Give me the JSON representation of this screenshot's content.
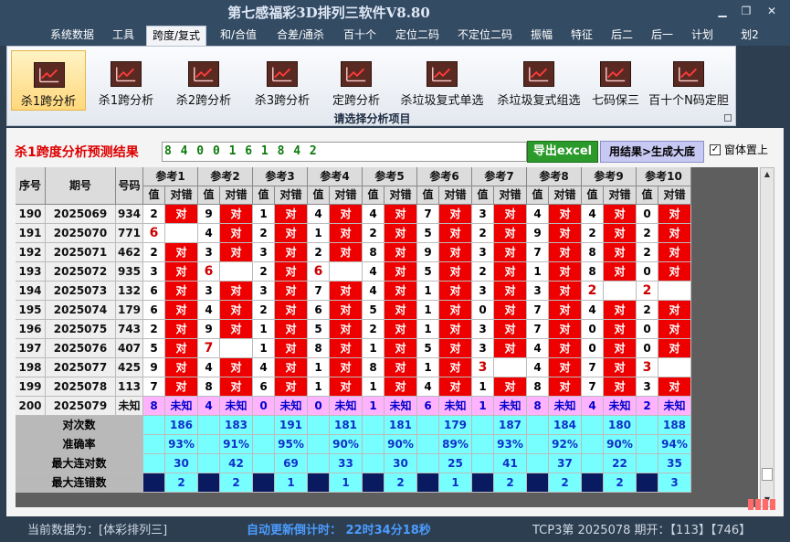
{
  "window": {
    "title": "第七感福彩3D排列三软件V8.80",
    "controls": [
      "minimize-icon",
      "restore-icon",
      "close-icon"
    ]
  },
  "menu": {
    "tabs": [
      "系统数据",
      "工具",
      "跨度/复式",
      "和/合值",
      "合差/通杀",
      "百十个",
      "定位二码",
      "不定位二码",
      "振幅",
      "特征",
      "后二",
      "后一",
      "计划",
      "划2"
    ],
    "active": "跨度/复式"
  },
  "ribbon": {
    "buttons": [
      "杀1跨分析",
      "杀1跨分析",
      "杀2跨分析",
      "杀3跨分析",
      "定跨分析",
      "杀垃圾复式单选",
      "杀垃圾复式组选",
      "七码保三",
      "百十个N码定胆"
    ],
    "active_index": 0,
    "caption": "请选择分析项目",
    "accent": "#ffd87b"
  },
  "result": {
    "title": "杀1跨度分析预测结果",
    "value": "8 4 0 0 1 6 1 8 4 2",
    "export_button": "导出excel",
    "generate_button": "用结果>生成大底",
    "keep_on_top_label": "窗体置上",
    "keep_on_top_checked": true,
    "check_mark": "✓"
  },
  "table": {
    "headers": {
      "index": "序号",
      "issue": "期号",
      "number": "号码",
      "refs": [
        "参考1",
        "参考2",
        "参考3",
        "参考4",
        "参考5",
        "参考6",
        "参考7",
        "参考8",
        "参考9",
        "参考10"
      ],
      "value": "值",
      "check": "对错"
    },
    "correct_label": "对",
    "rows": [
      {
        "idx": "190",
        "issue": "2025069",
        "num": "934",
        "v": [
          "2",
          "9",
          "1",
          "4",
          "4",
          "7",
          "3",
          "4",
          "4",
          "0"
        ],
        "ok": [
          1,
          1,
          1,
          1,
          1,
          1,
          1,
          1,
          1,
          1
        ]
      },
      {
        "idx": "191",
        "issue": "2025070",
        "num": "771",
        "v": [
          "6",
          "4",
          "2",
          "1",
          "2",
          "5",
          "2",
          "9",
          "2",
          "2"
        ],
        "ok": [
          0,
          1,
          1,
          1,
          1,
          1,
          1,
          1,
          1,
          1
        ]
      },
      {
        "idx": "192",
        "issue": "2025071",
        "num": "462",
        "v": [
          "2",
          "3",
          "3",
          "2",
          "8",
          "9",
          "3",
          "7",
          "8",
          "2"
        ],
        "ok": [
          1,
          1,
          1,
          1,
          1,
          1,
          1,
          1,
          1,
          1
        ]
      },
      {
        "idx": "193",
        "issue": "2025072",
        "num": "935",
        "v": [
          "3",
          "6",
          "2",
          "6",
          "4",
          "5",
          "2",
          "1",
          "8",
          "0"
        ],
        "ok": [
          1,
          0,
          1,
          0,
          1,
          1,
          1,
          1,
          1,
          1
        ]
      },
      {
        "idx": "194",
        "issue": "2025073",
        "num": "132",
        "v": [
          "6",
          "3",
          "3",
          "7",
          "4",
          "1",
          "3",
          "3",
          "2",
          "2"
        ],
        "ok": [
          1,
          1,
          1,
          1,
          1,
          1,
          1,
          1,
          0,
          0
        ]
      },
      {
        "idx": "195",
        "issue": "2025074",
        "num": "179",
        "v": [
          "6",
          "4",
          "2",
          "6",
          "5",
          "1",
          "0",
          "7",
          "4",
          "2"
        ],
        "ok": [
          1,
          1,
          1,
          1,
          1,
          1,
          1,
          1,
          1,
          1
        ]
      },
      {
        "idx": "196",
        "issue": "2025075",
        "num": "743",
        "v": [
          "2",
          "9",
          "1",
          "5",
          "2",
          "1",
          "3",
          "7",
          "0",
          "0"
        ],
        "ok": [
          1,
          1,
          1,
          1,
          1,
          1,
          1,
          1,
          1,
          1
        ]
      },
      {
        "idx": "197",
        "issue": "2025076",
        "num": "407",
        "v": [
          "5",
          "7",
          "1",
          "8",
          "1",
          "5",
          "3",
          "4",
          "0",
          "0"
        ],
        "ok": [
          1,
          0,
          1,
          1,
          1,
          1,
          1,
          1,
          1,
          1
        ]
      },
      {
        "idx": "198",
        "issue": "2025077",
        "num": "425",
        "v": [
          "9",
          "4",
          "4",
          "1",
          "8",
          "1",
          "3",
          "4",
          "7",
          "3"
        ],
        "ok": [
          1,
          1,
          1,
          1,
          1,
          1,
          0,
          1,
          1,
          0
        ]
      },
      {
        "idx": "199",
        "issue": "2025078",
        "num": "113",
        "v": [
          "7",
          "8",
          "6",
          "1",
          "1",
          "4",
          "1",
          "8",
          "7",
          "3"
        ],
        "ok": [
          1,
          1,
          1,
          1,
          1,
          1,
          1,
          1,
          1,
          1
        ]
      }
    ],
    "pending": {
      "idx": "200",
      "issue": "2025079",
      "num": "未知",
      "v": [
        "8",
        "4",
        "0",
        "0",
        "1",
        "6",
        "1",
        "8",
        "4",
        "2"
      ],
      "label": "未知"
    },
    "stats": [
      {
        "label": "对次数",
        "values": [
          "186",
          "183",
          "191",
          "181",
          "181",
          "179",
          "187",
          "184",
          "180",
          "188"
        ]
      },
      {
        "label": "准确率",
        "values": [
          "93%",
          "91%",
          "95%",
          "90%",
          "90%",
          "89%",
          "93%",
          "92%",
          "90%",
          "94%"
        ]
      },
      {
        "label": "最大连对数",
        "values": [
          "30",
          "42",
          "69",
          "33",
          "30",
          "25",
          "41",
          "37",
          "22",
          "35"
        ]
      },
      {
        "label": "最大连错数",
        "values": [
          "2",
          "2",
          "1",
          "1",
          "2",
          "1",
          "2",
          "2",
          "2",
          "3"
        ]
      }
    ]
  },
  "status": {
    "current_data": "当前数据为：[体彩排列三]",
    "countdown": "自动更新倒计时： 22时34分18秒",
    "last_draw": "TCP3第 2025078 期开：【113】【746】"
  },
  "colors": {
    "miss": "#ee0000",
    "pending": "#ffb3ff",
    "stats": "#77ffff",
    "export_button": "#2a9a2a"
  }
}
